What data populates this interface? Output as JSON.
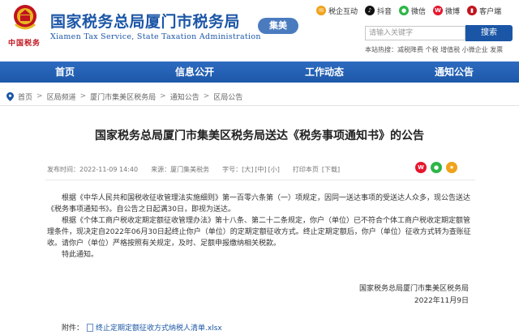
{
  "header": {
    "title": "国家税务总局厦门市税务局",
    "title_en": "Xiamen Tax Service, State Taxation Administration",
    "district": "集美",
    "emblem_caption": "中国税务",
    "social": [
      {
        "icon": "tax-interaction-icon",
        "label": "税企互动",
        "color": "#f0a21a",
        "glyph": "✉"
      },
      {
        "icon": "douyin-icon",
        "label": "抖音",
        "color": "#111111",
        "glyph": "♪"
      },
      {
        "icon": "wechat-icon",
        "label": "微信",
        "color": "#2fb548",
        "glyph": "●"
      },
      {
        "icon": "weibo-icon",
        "label": "微博",
        "color": "#e6162d",
        "glyph": "W"
      },
      {
        "icon": "client-icon",
        "label": "客户端",
        "color": "#c0141e",
        "glyph": "▮"
      }
    ],
    "search": {
      "placeholder": "请输入关键字",
      "button": "搜索",
      "hot": "本站热搜：减税降费 个税 增值税 小微企业 发票"
    }
  },
  "nav": [
    "首页",
    "信息公开",
    "工作动态",
    "通知公告"
  ],
  "breadcrumb": [
    "首页",
    "区局频道",
    "厦门市集美区税务局",
    "通知公告",
    "区局公告"
  ],
  "article": {
    "title": "国家税务总局厦门市集美区税务局送达《税务事项通知书》的公告",
    "meta": {
      "published": "发布时间：2022-11-09 14:40",
      "source": "来源：厦门集美税务",
      "font_label": "字号：",
      "font_large": "[大]",
      "font_medium": "[中]",
      "font_small": "[小]",
      "print": "打印本页",
      "download": "[下载]"
    },
    "paragraphs": [
      "根据《中华人民共和国税收征收管理法实施细则》第一百零六条第（一）项规定，因同一送达事项的受送达人众多，现公告送达《税务事项通知书》。自公告之日起满30日，即视为送达。",
      "根据《个体工商户税收定期定额征收管理办法》第十八条、第二十二条规定，你户（单位）已不符合个体工商户税收定期定额管理条件，现决定自2022年06月30日起终止你户（单位）的定期定额征收方式。终止定期定额后，你户（单位）征收方式转为查账征收。请你户（单位）严格按照有关规定，及时、足额申报缴纳相关税款。",
      "特此通知。"
    ],
    "signature_org": "国家税务总局厦门市集美区税务局",
    "signature_date": "2022年11月9日",
    "attachment_label": "附件：",
    "attachment_file": "终止定期定额征收方式纳税人清单.xlsx"
  },
  "colors": {
    "brand_blue": "#1b56a6",
    "nav_blue": "#2d6bc0",
    "badge_blue": "#4b7bbf",
    "red": "#c0141e"
  }
}
